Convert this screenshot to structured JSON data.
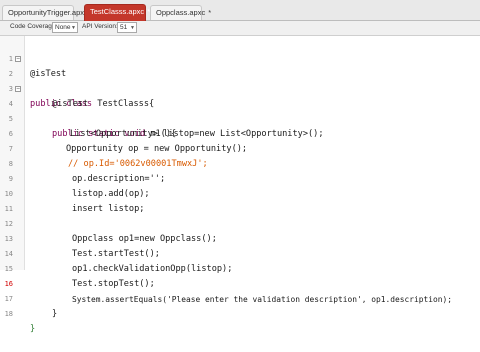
{
  "tabs": [
    {
      "label": "OpportunityTrigger.apxt",
      "close": "*"
    },
    {
      "label": "TestClasss.apxc",
      "close": "*"
    },
    {
      "label": "Oppclass.apxc",
      "close": "*"
    }
  ],
  "toolbar": {
    "coverage_label": "Code Coverage:",
    "coverage_value": "None",
    "api_label": "API Version:",
    "api_value": "51"
  },
  "line_numbers": [
    "1",
    "2",
    "3",
    "4",
    "5",
    "6",
    "7",
    "8",
    "9",
    "10",
    "11",
    "12",
    "13",
    "14",
    "15",
    "16",
    "17",
    "18"
  ],
  "code": {
    "l1": "@isTest",
    "l2a": "public class",
    "l2b": " TestClasss{",
    "l3": "@isTest",
    "l4a": "public static void",
    "l4b": " m1(){",
    "l5": "List<Opportunity> listop=new List<Opportunity>();",
    "l6": "Opportunity op = new Opportunity();",
    "l7": "// op.Id='0062v00001TmwxJ';",
    "l8": "op.description='';",
    "l9": "listop.add(op);",
    "l10": "insert listop;",
    "l11": "",
    "l12": "Oppclass op1=new Oppclass();",
    "l13": "Test.startTest();",
    "l14": "op1.checkValidationOpp(listop);",
    "l15": "Test.stopTest();",
    "l16": "System.assertEquals('Please enter the validation description', op1.description);",
    "l17": "}",
    "l18": "}"
  },
  "colors": {
    "active_tab": "#c4372a",
    "keyword": "#7f0055",
    "comment": "#d85a00",
    "error_marker": "#d10000"
  }
}
